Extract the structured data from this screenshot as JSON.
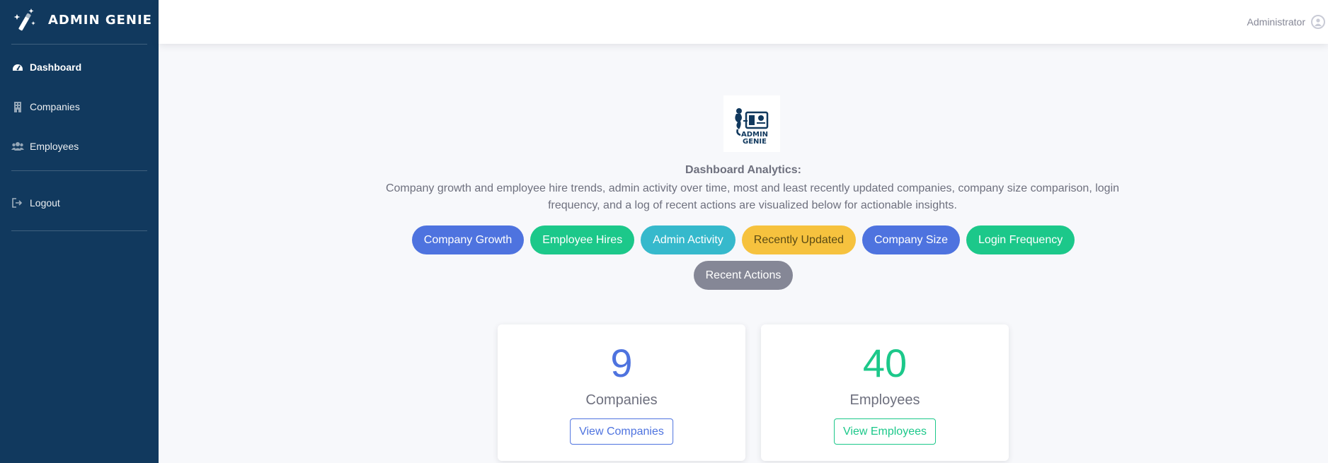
{
  "app": {
    "brand_name": "ADMIN GENIE",
    "brand_icon": "magic-wand-icon"
  },
  "sidebar": {
    "items": [
      {
        "label": "Dashboard",
        "icon": "dashboard-icon",
        "active": true
      },
      {
        "label": "Companies",
        "icon": "building-icon",
        "active": false
      },
      {
        "label": "Employees",
        "icon": "users-icon",
        "active": false
      }
    ],
    "logout": {
      "label": "Logout",
      "icon": "sign-out-icon"
    }
  },
  "topbar": {
    "user_name": "Administrator",
    "user_icon": "user-circle-icon"
  },
  "dashboard": {
    "logo_text_line1": "ADMIN",
    "logo_text_line2": "GENIE",
    "title": "Dashboard Analytics:",
    "description": "Company growth and employee hire trends, admin activity over time, most and least recently updated companies, company size comparison, login frequency, and a log of recent actions are visualized below for actionable insights.",
    "chart_buttons": [
      {
        "label": "Company Growth",
        "color": "#4e73df",
        "text_color": "#ffffff"
      },
      {
        "label": "Employee Hires",
        "color": "#1cc88a",
        "text_color": "#ffffff"
      },
      {
        "label": "Admin Activity",
        "color": "#36b9cc",
        "text_color": "#ffffff"
      },
      {
        "label": "Recently Updated",
        "color": "#f6c23e",
        "text_color": "#5a4a14"
      },
      {
        "label": "Company Size",
        "color": "#4e73df",
        "text_color": "#ffffff"
      },
      {
        "label": "Login Frequency",
        "color": "#1cc88a",
        "text_color": "#ffffff"
      },
      {
        "label": "Recent Actions",
        "color": "#858796",
        "text_color": "#ffffff"
      }
    ]
  },
  "stats": [
    {
      "value": "9",
      "label": "Companies",
      "button": "View Companies",
      "color": "#4e73df"
    },
    {
      "value": "40",
      "label": "Employees",
      "button": "View Employees",
      "color": "#1cc88a"
    }
  ],
  "colors": {
    "sidebar_bg": "#11395e",
    "page_bg": "#f7f8fb"
  }
}
